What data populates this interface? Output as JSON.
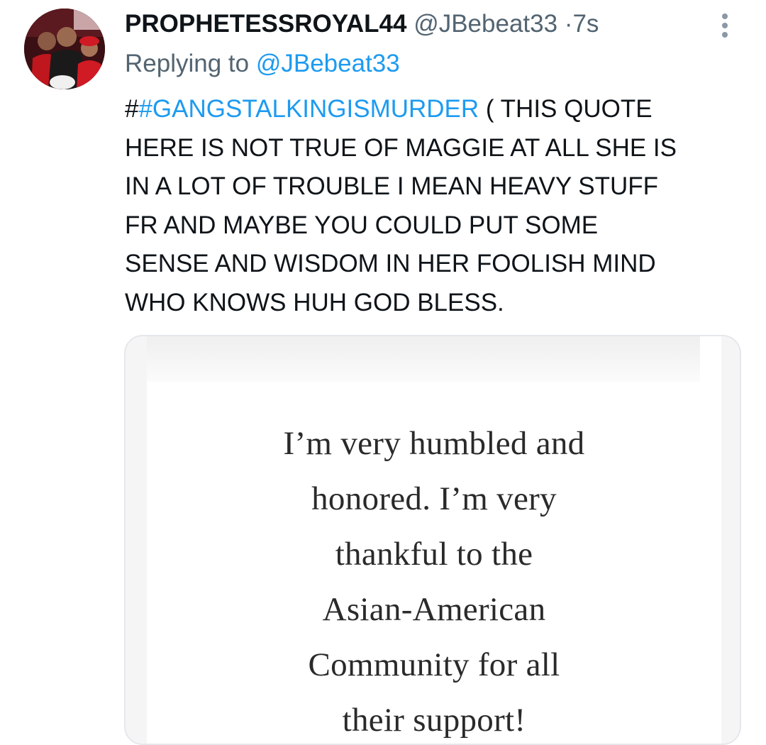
{
  "tweet": {
    "display_name": "PROPHETESSROYAL44",
    "handle": "@JBebeat33",
    "separator": "·",
    "time": "7s",
    "replying_prefix": "Replying to",
    "replying_handle": "@JBebeat33",
    "hashtag_prefix": "#",
    "hashtag": "#GANGSTALKINGISMURDER",
    "text": " ( THIS QUOTE\nHERE IS NOT TRUE OF MAGGIE AT ALL SHE IS\nIN A LOT OF TROUBLE I MEAN HEAVY STUFF\nFR AND MAYBE YOU COULD PUT SOME\nSENSE AND WISDOM IN HER FOOLISH MIND\nWHO KNOWS HUH GOD BLESS.",
    "more_icon": "vertical-ellipsis-icon"
  },
  "media": {
    "quote": "I’m very humbled and\nhonored. I’m very\nthankful to the\nAsian-American\nCommunity for all\ntheir support!"
  },
  "colors": {
    "link": "#1d9bf0",
    "secondary_text": "#536471",
    "primary_text": "#0f1419",
    "media_border": "#e4e8ec"
  }
}
